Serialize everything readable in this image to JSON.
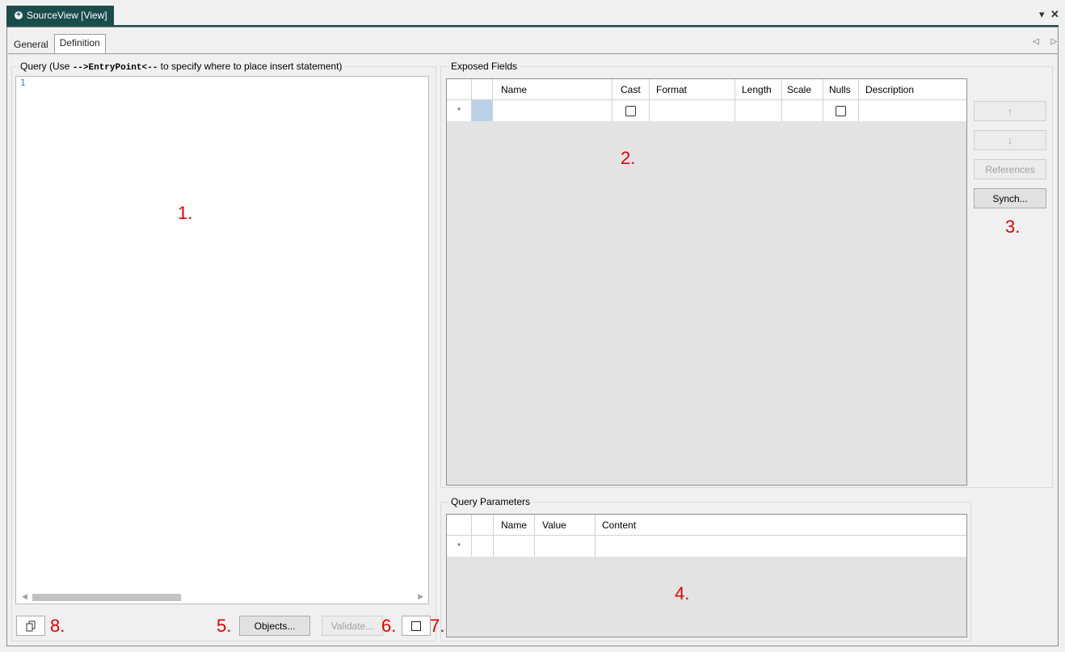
{
  "window": {
    "doc_tab_label": "SourceView [View]",
    "doc_tab_icon": "plus-circle-icon",
    "dropdown_glyph": "▾",
    "close_glyph": "✕",
    "scroll_glyphs": "◁ ▷"
  },
  "tabs": [
    {
      "label": "General",
      "active": false
    },
    {
      "label": "Definition",
      "active": true
    }
  ],
  "query": {
    "label_prefix": "Query (Use ",
    "label_code": "-->EntryPoint<--",
    "label_suffix": " to specify where to place insert statement)",
    "line_number": "1",
    "scroll_left_glyph": "◀",
    "scroll_right_glyph": "▶"
  },
  "exposed_fields": {
    "label": "Exposed Fields",
    "columns": [
      "Name",
      "Cast",
      "Format",
      "Length",
      "Scale",
      "Nulls",
      "Description"
    ],
    "new_row_marker": "*",
    "buttons": {
      "move_up": "↑",
      "move_down": "↓",
      "references": "References",
      "synch": "Synch..."
    }
  },
  "query_parameters": {
    "label": "Query Parameters",
    "columns": [
      "Name",
      "Value",
      "Content"
    ],
    "new_row_marker": "*"
  },
  "bottom_bar": {
    "objects": "Objects...",
    "validate": "Validate...",
    "copy_icon": "copy-icon"
  },
  "annotations": [
    "1.",
    "2.",
    "3.",
    "4.",
    "5.",
    "6.",
    "7.",
    "8."
  ],
  "colors": {
    "tab_accent": "#1b4c4c",
    "annotation": "#e00000",
    "line_number": "#2b91af",
    "selected_cell": "#b9d1e6"
  }
}
